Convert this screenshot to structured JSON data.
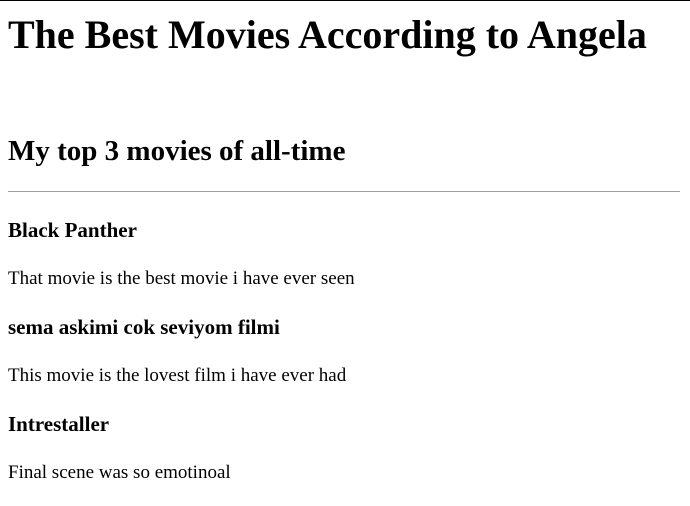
{
  "page": {
    "title": "The Best Movies According to Angela",
    "subtitle": "My top 3 movies of all-time"
  },
  "movies": [
    {
      "title": "Black Panther",
      "description": "That movie is the best movie i have ever seen"
    },
    {
      "title": "sema askimi cok seviyom filmi",
      "description": "This movie is the lovest film i have ever had"
    },
    {
      "title": "Intrestaller",
      "description": "Final scene was so emotinoal"
    }
  ]
}
